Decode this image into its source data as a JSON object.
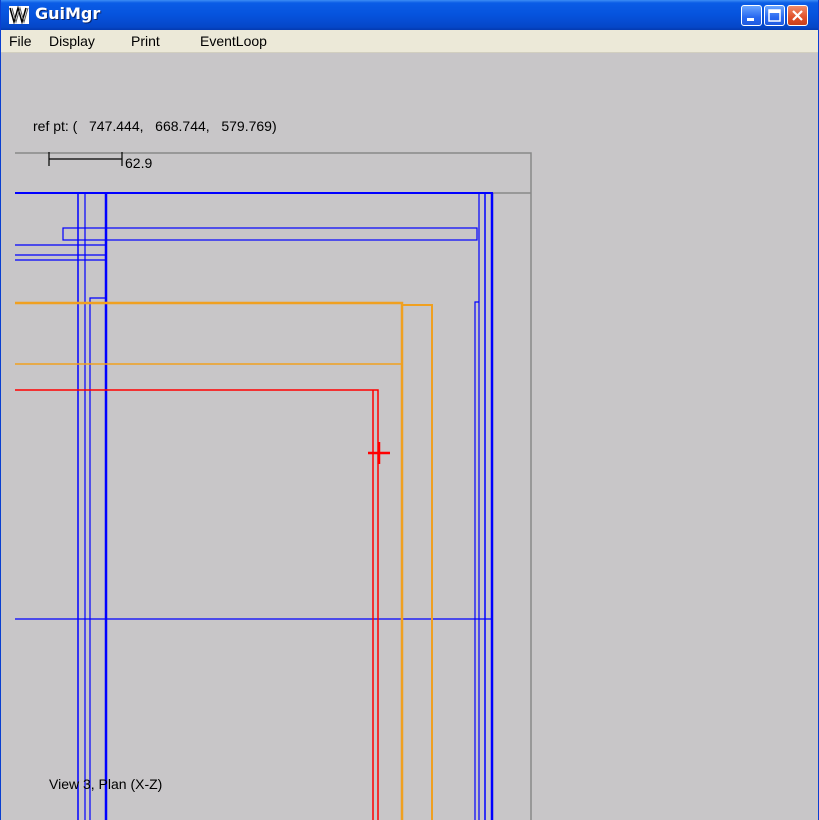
{
  "window": {
    "title": "GuiMgr",
    "app_icon": "guimgr-app-icon",
    "controls": [
      "minimize-icon",
      "maximize-icon",
      "close-icon"
    ]
  },
  "menu": {
    "items": [
      "File",
      "Display",
      "Print",
      "EventLoop"
    ]
  },
  "viewport": {
    "ref_point": "ref pt: (   747.444,   668.744,   579.769)",
    "scale_label": "62.9",
    "view_label": "View 3, Plan (X-Z)"
  },
  "colors": {
    "background": "#c8c6c8",
    "outline": "#0000ff",
    "orange": "#f0a020",
    "red": "#ff0000",
    "frame": "#888888"
  }
}
